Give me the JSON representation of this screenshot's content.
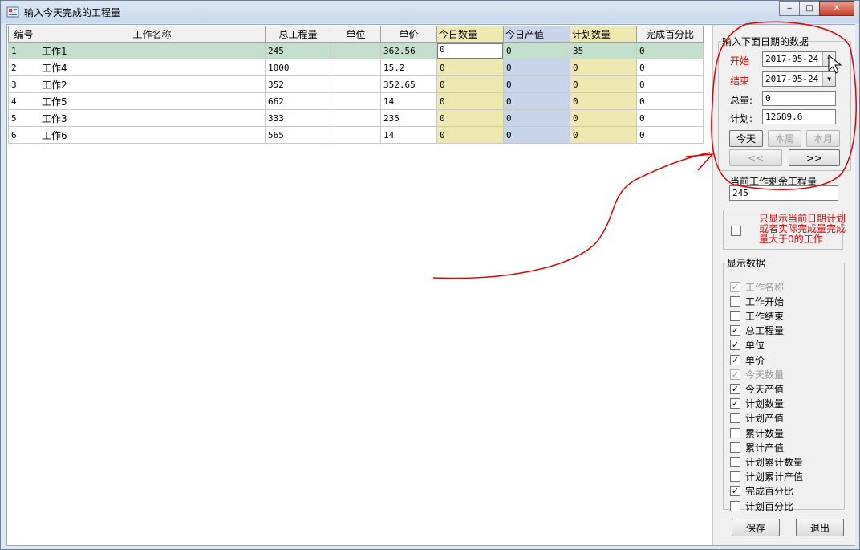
{
  "window": {
    "title": "输入今天完成的工程量",
    "minimize": "‒",
    "restore": "□",
    "close": "✕"
  },
  "grid": {
    "headers": [
      "编号",
      "工作名称",
      "总工程量",
      "单位",
      "单价",
      "今日数量",
      "今日产值",
      "计划数量",
      "完成百分比"
    ],
    "rows": [
      {
        "id": "1",
        "name": "工作1",
        "total": "245",
        "unit": "",
        "price": "362.56",
        "today_qty": "0",
        "today_value": "0",
        "plan_qty": "35",
        "pct": "0"
      },
      {
        "id": "2",
        "name": "工作4",
        "total": "1000",
        "unit": "",
        "price": "15.2",
        "today_qty": "0",
        "today_value": "0",
        "plan_qty": "0",
        "pct": "0"
      },
      {
        "id": "3",
        "name": "工作2",
        "total": "352",
        "unit": "",
        "price": "352.65",
        "today_qty": "0",
        "today_value": "0",
        "plan_qty": "0",
        "pct": "0"
      },
      {
        "id": "4",
        "name": "工作5",
        "total": "662",
        "unit": "",
        "price": "14",
        "today_qty": "0",
        "today_value": "0",
        "plan_qty": "0",
        "pct": "0"
      },
      {
        "id": "5",
        "name": "工作3",
        "total": "333",
        "unit": "",
        "price": "235",
        "today_qty": "0",
        "today_value": "0",
        "plan_qty": "0",
        "pct": "0"
      },
      {
        "id": "6",
        "name": "工作6",
        "total": "565",
        "unit": "",
        "price": "14",
        "today_qty": "0",
        "today_value": "0",
        "plan_qty": "0",
        "pct": "0"
      }
    ],
    "selected_row": 0
  },
  "date_group": {
    "legend": "输入下面日期的数据",
    "start_label": "开始",
    "start_value": "2017-05-24",
    "end_label": "结束",
    "end_value": "2017-05-24",
    "total_label": "总量:",
    "total_value": "0",
    "plan_label": "计划:",
    "plan_value": "12689.6",
    "btn_today": "今天",
    "btn_week": "本周",
    "btn_month": "本月",
    "btn_prev": "<<",
    "btn_next": ">>"
  },
  "remaining": {
    "legend": "当前工作剩余工程量",
    "value": "245"
  },
  "filter": {
    "text": "只显示当前日期计划或者实际完成量完成量大于0的工作",
    "checked": false
  },
  "display": {
    "legend": "显示数据",
    "items": [
      {
        "label": "工作名称",
        "checked": true,
        "disabled": true
      },
      {
        "label": "工作开始",
        "checked": false,
        "disabled": false
      },
      {
        "label": "工作结束",
        "checked": false,
        "disabled": false
      },
      {
        "label": "总工程量",
        "checked": true,
        "disabled": false
      },
      {
        "label": "单位",
        "checked": true,
        "disabled": false
      },
      {
        "label": "单价",
        "checked": true,
        "disabled": false
      },
      {
        "label": "今天数量",
        "checked": true,
        "disabled": true
      },
      {
        "label": "今天产值",
        "checked": true,
        "disabled": false
      },
      {
        "label": "计划数量",
        "checked": true,
        "disabled": false
      },
      {
        "label": "计划产值",
        "checked": false,
        "disabled": false
      },
      {
        "label": "累计数量",
        "checked": false,
        "disabled": false
      },
      {
        "label": "累计产值",
        "checked": false,
        "disabled": false
      },
      {
        "label": "计划累计数量",
        "checked": false,
        "disabled": false
      },
      {
        "label": "计划累计产值",
        "checked": false,
        "disabled": false
      },
      {
        "label": "完成百分比",
        "checked": true,
        "disabled": false
      },
      {
        "label": "计划百分比",
        "checked": false,
        "disabled": false
      }
    ]
  },
  "actions": {
    "save": "保存",
    "exit": "退出"
  },
  "colors": {
    "annotation": "#e00000",
    "today_column": "#ede9b1",
    "value_column": "#c8d4ea",
    "selected_row": "#c4e0cc"
  }
}
